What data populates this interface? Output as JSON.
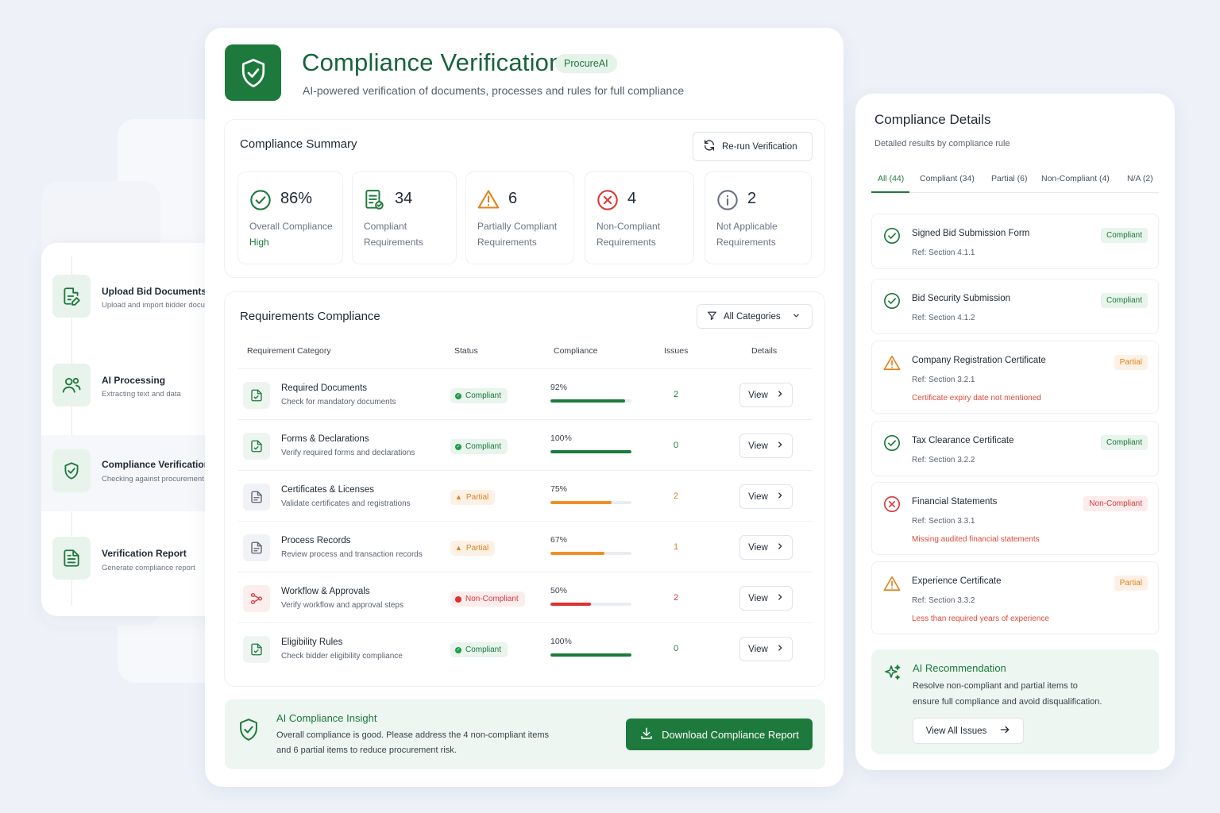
{
  "app": {
    "title": "Compliance Verification",
    "brand": "ProcureAI",
    "subtitle": "AI-powered verification of documents, processes and rules for full compliance"
  },
  "colors": {
    "primary": "#1e7a3c",
    "compliant": "#1b7a3c",
    "partial": "#e0821e",
    "noncompliant": "#d93b3b",
    "background": "#eef1f8"
  },
  "steps": [
    {
      "title": "Upload Bid Documents",
      "desc": "Upload and import bidder documents",
      "icon": "file-edit-icon"
    },
    {
      "title": "AI Processing",
      "desc": "Extracting text and data",
      "icon": "users-icon"
    },
    {
      "title": "Compliance Verification",
      "desc": "Checking against procurement rules",
      "icon": "shield-check-icon"
    },
    {
      "title": "Verification Report",
      "desc": "Generate compliance report",
      "icon": "document-icon"
    }
  ],
  "summary": {
    "title": "Compliance Summary",
    "rerun_label": "Re-run Verification",
    "stats": [
      {
        "value": "86%",
        "line1": "Overall Compliance",
        "line2": "High",
        "icon": "check-circle-icon"
      },
      {
        "value": "34",
        "line1": "Compliant",
        "line2": "Requirements",
        "icon": "file-check-icon"
      },
      {
        "value": "6",
        "line1": "Partially Compliant",
        "line2": "Requirements",
        "icon": "warning-icon"
      },
      {
        "value": "4",
        "line1": "Non-Compliant",
        "line2": "Requirements",
        "icon": "x-circle-icon"
      },
      {
        "value": "2",
        "line1": "Not Applicable",
        "line2": "Requirements",
        "icon": "info-icon"
      }
    ]
  },
  "requirements": {
    "title": "Requirements Compliance",
    "filter_label": "All Categories",
    "columns": [
      "Requirement Category",
      "Status",
      "Compliance",
      "Issues",
      "Details"
    ],
    "view_label": "View",
    "rows": [
      {
        "name": "Required Documents",
        "desc": "Check for mandatory documents",
        "status": "Compliant",
        "kind": "c",
        "pct_label": "92%",
        "pct": 92,
        "issues": "2"
      },
      {
        "name": "Forms & Declarations",
        "desc": "Verify required forms and declarations",
        "status": "Compliant",
        "kind": "c",
        "pct_label": "100%",
        "pct": 100,
        "issues": "0"
      },
      {
        "name": "Certificates & Licenses",
        "desc": "Validate certificates and registrations",
        "status": "Partial",
        "kind": "p",
        "pct_label": "75%",
        "pct": 75,
        "issues": "2"
      },
      {
        "name": "Process Records",
        "desc": "Review process and transaction records",
        "status": "Partial",
        "kind": "p",
        "pct_label": "67%",
        "pct": 67,
        "issues": "1"
      },
      {
        "name": "Workflow & Approvals",
        "desc": "Verify workflow and approval steps",
        "status": "Non-Compliant",
        "kind": "n",
        "pct_label": "50%",
        "pct": 50,
        "issues": "2"
      },
      {
        "name": "Eligibility Rules",
        "desc": "Check bidder eligibility compliance",
        "status": "Compliant",
        "kind": "c",
        "pct_label": "100%",
        "pct": 100,
        "issues": "0"
      }
    ]
  },
  "insight": {
    "title": "AI Compliance Insight",
    "line1": "Overall compliance is good. Please address the 4 non-compliant items",
    "line2": "and 6 partial items to reduce procurement risk.",
    "download_label": "Download Compliance Report"
  },
  "details": {
    "title": "Compliance Details",
    "subtitle": "Detailed results by compliance rule",
    "tabs": [
      "All (44)",
      "Compliant (34)",
      "Partial (6)",
      "Non-Compliant (4)",
      "N/A (2)"
    ],
    "items": [
      {
        "name": "Signed Bid Submission Form",
        "ref": "Ref: Section 4.1.1",
        "status": "Compliant",
        "kind": "c",
        "note": ""
      },
      {
        "name": "Bid Security Submission",
        "ref": "Ref: Section 4.1.2",
        "status": "Compliant",
        "kind": "c",
        "note": ""
      },
      {
        "name": "Company Registration Certificate",
        "ref": "Ref: Section 3.2.1",
        "status": "Partial",
        "kind": "p",
        "note": "Certificate expiry date not mentioned"
      },
      {
        "name": "Tax Clearance Certificate",
        "ref": "Ref: Section 3.2.2",
        "status": "Compliant",
        "kind": "c",
        "note": ""
      },
      {
        "name": "Financial Statements",
        "ref": "Ref: Section 3.3.1",
        "status": "Non-Compliant",
        "kind": "n",
        "note": "Missing audited financial statements"
      },
      {
        "name": "Experience Certificate",
        "ref": "Ref: Section 3.3.2",
        "status": "Partial",
        "kind": "p",
        "note": "Less than required years of experience"
      }
    ],
    "recommendation": {
      "title": "AI Recommendation",
      "line1": "Resolve non-compliant and partial items to",
      "line2": "ensure full compliance and avoid disqualification.",
      "button": "View All Issues"
    }
  }
}
